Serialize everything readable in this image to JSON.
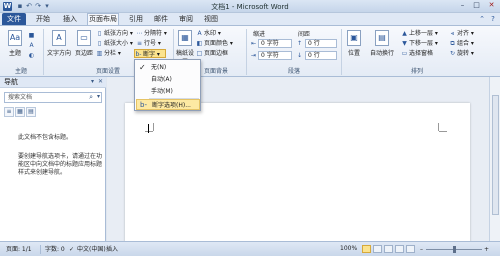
{
  "title_bar": {
    "app_icon": "W",
    "title": "文档1 - Microsoft Word",
    "quick_access": [
      "save-icon",
      "undo-icon",
      "redo-icon"
    ],
    "window_controls": [
      "minimize-icon",
      "maximize-icon",
      "close-icon"
    ]
  },
  "tabs": {
    "file": "文件",
    "items": [
      "开始",
      "插入",
      "页面布局",
      "引用",
      "邮件",
      "审阅",
      "视图"
    ],
    "active_index": 2
  },
  "ribbon": {
    "theme_group": {
      "label": "主题",
      "theme_button": "主题"
    },
    "page_setup_group": {
      "label": "页面设置",
      "text_direction": "文字方向",
      "margins": "页边距",
      "orientation": "纸张方向",
      "size": "纸张大小",
      "columns": "分栏",
      "breaks": "分隔符",
      "line_numbers": "行号",
      "hyphenation": "断字"
    },
    "background_group": {
      "label": "页面背景",
      "watermark": "水印",
      "page_color": "页面颜色",
      "page_borders": "页面边框",
      "manuscript": "稿纸设置"
    },
    "paragraph_group": {
      "label": "段落",
      "indent_title": "缩进",
      "spacing_title": "间距",
      "indent_left": "0 字符",
      "indent_right": "0 字符",
      "space_before": "0 行",
      "space_after": "0 行"
    },
    "arrange_group": {
      "label": "排列",
      "position": "位置",
      "wrap_text": "自动换行",
      "bring_forward": "上移一层",
      "send_backward": "下移一层",
      "selection_pane": "选择窗格",
      "align": "对齐",
      "group": "组合",
      "rotate": "旋转"
    }
  },
  "hyphenation_menu": {
    "items": [
      "无(N)",
      "自动(A)",
      "手动(M)",
      "断字选项(H)..."
    ],
    "checked_index": 0,
    "highlighted_index": 3
  },
  "nav_pane": {
    "title": "导航",
    "search_placeholder": "搜索文档",
    "message": "此文档不包含标题。",
    "hint": "要创建导航选项卡，请通过在功能区中向文档中的标题应用标题样式来创建导航。"
  },
  "status_bar": {
    "page": "页面: 1/1",
    "words": "字数: 0",
    "language": "中文(中国)",
    "insert_mode": "插入",
    "zoom": "100%"
  }
}
